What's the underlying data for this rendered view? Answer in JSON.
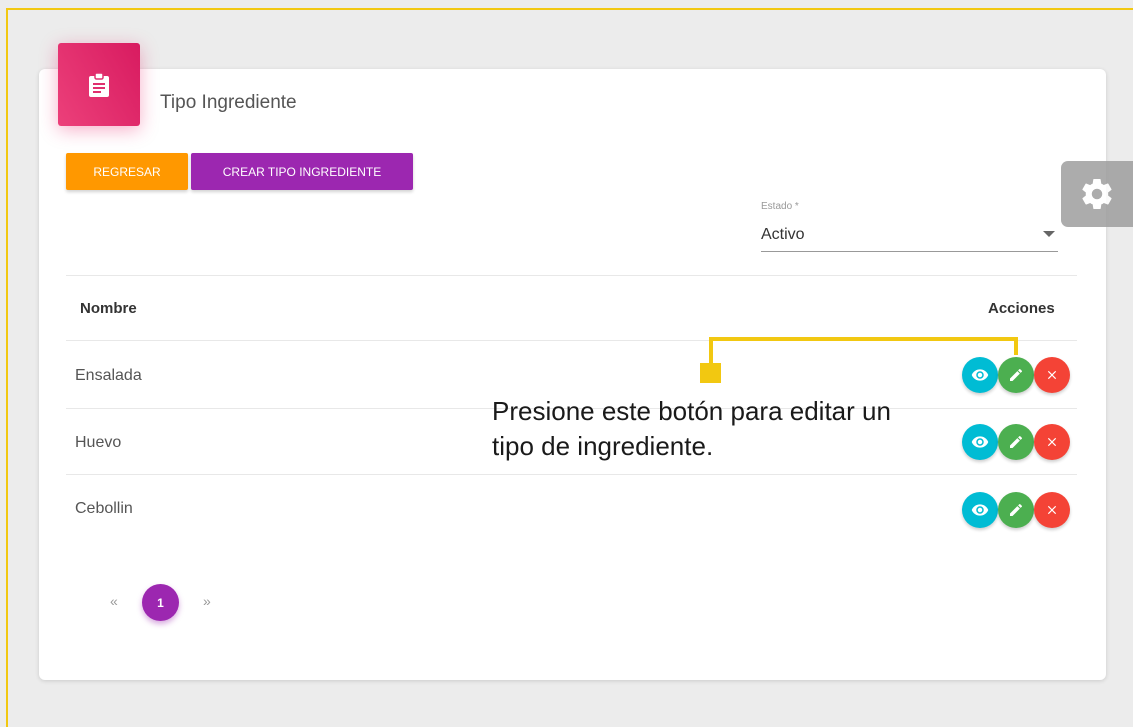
{
  "card": {
    "title": "Tipo Ingrediente",
    "icon": "clipboard-icon"
  },
  "toolbar": {
    "back_label": "REGRESAR",
    "create_label": "CREAR TIPO INGREDIENTE"
  },
  "settings": {
    "icon": "gear-icon"
  },
  "filter": {
    "label": "Estado *",
    "value": "Activo"
  },
  "table": {
    "headers": {
      "name": "Nombre",
      "actions": "Acciones"
    },
    "rows": [
      {
        "name": "Ensalada"
      },
      {
        "name": "Huevo"
      },
      {
        "name": "Cebollin"
      }
    ],
    "action_icons": [
      "eye-icon",
      "pencil-icon",
      "close-icon"
    ]
  },
  "pagination": {
    "prev": "«",
    "current": "1",
    "next": "»"
  },
  "callout": {
    "text": "Presione este botón para editar un tipo de ingrediente."
  },
  "colors": {
    "accent_orange": "#ff9800",
    "accent_purple": "#9c27b0",
    "card_icon": "#e91e63",
    "view": "#00bcd4",
    "edit": "#4caf50",
    "delete": "#f44336",
    "callout": "#f2c811"
  }
}
